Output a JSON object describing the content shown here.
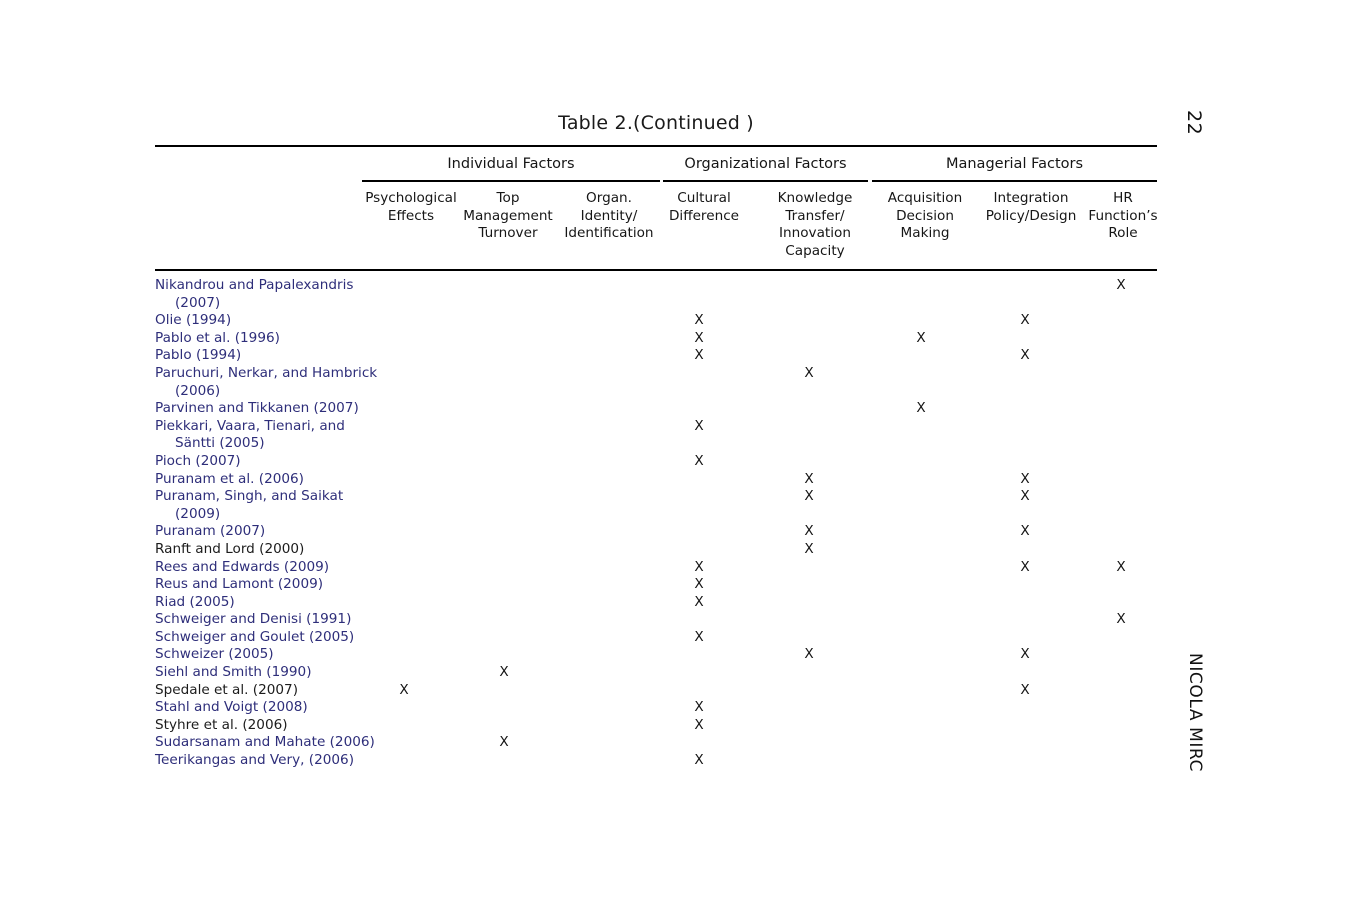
{
  "document": {
    "title": "Table 2.(Continued )",
    "page_number": "22",
    "running_head": "NICOLA MIRC"
  },
  "table": {
    "groups": [
      {
        "id": "individual",
        "label": "Individual Factors"
      },
      {
        "id": "organizational",
        "label": "Organizational Factors"
      },
      {
        "id": "managerial",
        "label": "Managerial Factors"
      }
    ],
    "columns": [
      {
        "id": "psychological_effects",
        "label": "Psychological\nEffects",
        "group": "individual"
      },
      {
        "id": "top_management_turnover",
        "label": "Top\nManagement\nTurnover",
        "group": "individual"
      },
      {
        "id": "organ_identity_identification",
        "label": "Organ.\nIdentity/\nIdentification",
        "group": "individual"
      },
      {
        "id": "cultural_difference",
        "label": "Cultural\nDifference",
        "group": "organizational"
      },
      {
        "id": "knowledge_transfer_innovation_capacity",
        "label": "Knowledge\nTransfer/\nInnovation\nCapacity",
        "group": "organizational"
      },
      {
        "id": "acquisition_decision_making",
        "label": "Acquisition\nDecision\nMaking",
        "group": "managerial"
      },
      {
        "id": "integration_policy_design",
        "label": "Integration\nPolicy/Design",
        "group": "managerial"
      },
      {
        "id": "hr_functions_role",
        "label": "HR\nFunction’s\nRole",
        "group": "managerial"
      }
    ],
    "mark": "X",
    "rows": [
      {
        "label": "Nikandrou and Papalexandris\n(2007)",
        "lines": 2,
        "color": "blue",
        "marks": [
          false,
          false,
          false,
          false,
          false,
          false,
          false,
          true
        ]
      },
      {
        "label": "Olie (1994)",
        "lines": 1,
        "color": "blue",
        "marks": [
          false,
          false,
          false,
          true,
          false,
          false,
          true,
          false
        ]
      },
      {
        "label": "Pablo et al. (1996)",
        "lines": 1,
        "color": "blue",
        "marks": [
          false,
          false,
          false,
          true,
          false,
          true,
          false,
          false
        ]
      },
      {
        "label": "Pablo (1994)",
        "lines": 1,
        "color": "blue",
        "marks": [
          false,
          false,
          false,
          true,
          false,
          false,
          true,
          false
        ]
      },
      {
        "label": "Paruchuri, Nerkar, and Hambrick\n(2006)",
        "lines": 2,
        "color": "blue",
        "marks": [
          false,
          false,
          false,
          false,
          true,
          false,
          false,
          false
        ]
      },
      {
        "label": "Parvinen and Tikkanen (2007)",
        "lines": 1,
        "color": "blue",
        "marks": [
          false,
          false,
          false,
          false,
          false,
          true,
          false,
          false
        ]
      },
      {
        "label": "Piekkari, Vaara, Tienari, and\nSäntti (2005)",
        "lines": 2,
        "color": "blue",
        "marks": [
          false,
          false,
          false,
          true,
          false,
          false,
          false,
          false
        ]
      },
      {
        "label": "Pioch (2007)",
        "lines": 1,
        "color": "blue",
        "marks": [
          false,
          false,
          false,
          true,
          false,
          false,
          false,
          false
        ]
      },
      {
        "label": "Puranam et al. (2006)",
        "lines": 1,
        "color": "blue",
        "marks": [
          false,
          false,
          false,
          false,
          true,
          false,
          true,
          false
        ]
      },
      {
        "label": "Puranam, Singh, and Saikat\n(2009)",
        "lines": 2,
        "color": "blue",
        "marks": [
          false,
          false,
          false,
          false,
          true,
          false,
          true,
          false
        ]
      },
      {
        "label": "Puranam (2007)",
        "lines": 1,
        "color": "blue",
        "marks": [
          false,
          false,
          false,
          false,
          true,
          false,
          true,
          false
        ]
      },
      {
        "label": "Ranft and Lord (2000)",
        "lines": 1,
        "color": "dark",
        "marks": [
          false,
          false,
          false,
          false,
          true,
          false,
          false,
          false
        ]
      },
      {
        "label": "Rees and Edwards (2009)",
        "lines": 1,
        "color": "blue",
        "marks": [
          false,
          false,
          false,
          true,
          false,
          false,
          true,
          true
        ]
      },
      {
        "label": "Reus and Lamont (2009)",
        "lines": 1,
        "color": "blue",
        "marks": [
          false,
          false,
          false,
          true,
          false,
          false,
          false,
          false
        ]
      },
      {
        "label": "Riad (2005)",
        "lines": 1,
        "color": "blue",
        "marks": [
          false,
          false,
          false,
          true,
          false,
          false,
          false,
          false
        ]
      },
      {
        "label": "Schweiger and Denisi (1991)",
        "lines": 1,
        "color": "blue",
        "marks": [
          false,
          false,
          false,
          false,
          false,
          false,
          false,
          true
        ]
      },
      {
        "label": "Schweiger and Goulet (2005)",
        "lines": 1,
        "color": "blue",
        "marks": [
          false,
          false,
          false,
          true,
          false,
          false,
          false,
          false
        ]
      },
      {
        "label": "Schweizer (2005)",
        "lines": 1,
        "color": "blue",
        "marks": [
          false,
          false,
          false,
          false,
          true,
          false,
          true,
          false
        ]
      },
      {
        "label": "Siehl and Smith (1990)",
        "lines": 1,
        "color": "blue",
        "marks": [
          false,
          true,
          false,
          false,
          false,
          false,
          false,
          false
        ]
      },
      {
        "label": "Spedale et al. (2007)",
        "lines": 1,
        "color": "dark",
        "marks": [
          true,
          false,
          false,
          false,
          false,
          false,
          true,
          false
        ]
      },
      {
        "label": "Stahl and Voigt (2008)",
        "lines": 1,
        "color": "blue",
        "marks": [
          false,
          false,
          false,
          true,
          false,
          false,
          false,
          false
        ]
      },
      {
        "label": "Styhre et al. (2006)",
        "lines": 1,
        "color": "dark",
        "marks": [
          false,
          false,
          false,
          true,
          false,
          false,
          false,
          false
        ]
      },
      {
        "label": "Sudarsanam and Mahate (2006)",
        "lines": 1,
        "color": "blue",
        "marks": [
          false,
          true,
          false,
          false,
          false,
          false,
          false,
          false
        ]
      },
      {
        "label": "Teerikangas and Very, (2006)",
        "lines": 1,
        "color": "blue",
        "marks": [
          false,
          false,
          false,
          true,
          false,
          false,
          false,
          false
        ]
      }
    ]
  },
  "style": {
    "link_color": "#2e2e7a",
    "text_color": "#1c1c1c",
    "rule_color": "#000000"
  }
}
